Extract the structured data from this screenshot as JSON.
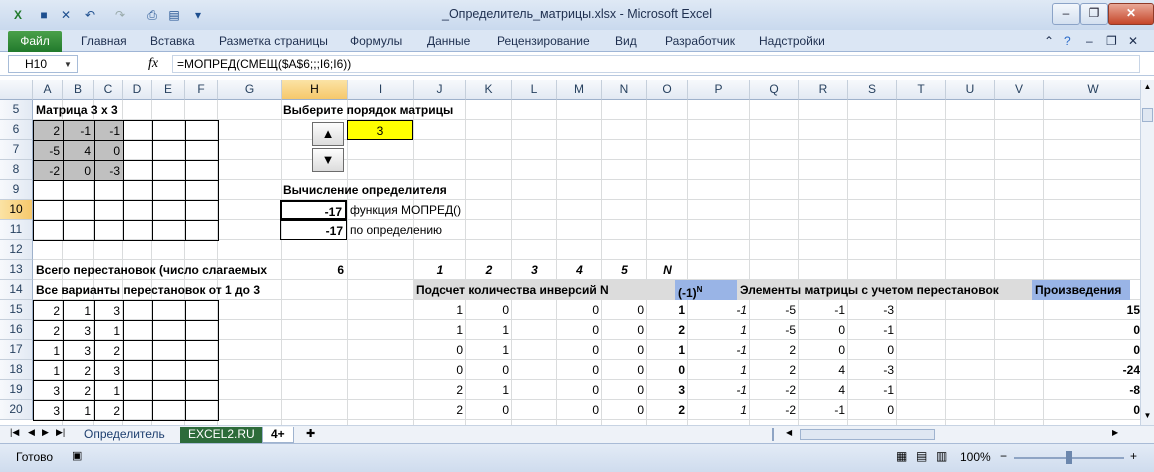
{
  "app": {
    "title": "_Определитель_матрицы.xlsx - Microsoft Excel",
    "file_tab": "Файл",
    "tabs": [
      "Главная",
      "Вставка",
      "Разметка страницы",
      "Формулы",
      "Данные",
      "Рецензирование",
      "Вид",
      "Разработчик",
      "Надстройки"
    ]
  },
  "formula_bar": {
    "name_box": "H10",
    "fx": "fx",
    "formula": "=МОПРЕД(СМЕЩ($A$6;;;I6;I6))"
  },
  "grid": {
    "columns": [
      "A",
      "B",
      "C",
      "D",
      "E",
      "F",
      "G",
      "H",
      "I",
      "J",
      "K",
      "L",
      "M",
      "N",
      "O",
      "P",
      "Q",
      "R",
      "S",
      "T",
      "U",
      "V",
      "W"
    ],
    "rows": [
      "5",
      "6",
      "7",
      "8",
      "9",
      "10",
      "11",
      "12",
      "13",
      "14",
      "15",
      "16",
      "17",
      "18",
      "19",
      "20"
    ],
    "selected_column": "H",
    "selected_row": "10"
  },
  "sheet": {
    "matrix_title": "Матрица 3 х 3",
    "matrix": [
      [
        "2",
        "-1",
        "-1"
      ],
      [
        "-5",
        "4",
        "0"
      ],
      [
        "-2",
        "0",
        "-3"
      ]
    ],
    "choose_order_label": "Выберите порядок матрицы",
    "order_value": "3",
    "spin_up": "▲",
    "spin_down": "▼",
    "calc_title": "Вычисление определителя",
    "det_func_value": "-17",
    "det_func_label": "функция МОПРЕД()",
    "det_def_value": "-17",
    "det_def_label": "по определению",
    "perm_total_label": "Всего перестановок (число слагаемых",
    "perm_total_value": "6",
    "index_header": [
      "1",
      "2",
      "3",
      "4",
      "5",
      "N"
    ],
    "perm_variants_label": "Все варианты перестановок от 1 до 3",
    "inversions_label": "Подсчет количества инверсий N",
    "sign_label": "(-1)",
    "sign_sup": "N",
    "elements_label": "Элементы матрицы с учетом перестановок",
    "products_label": "Произведения",
    "permutations": [
      [
        "2",
        "1",
        "3"
      ],
      [
        "2",
        "3",
        "1"
      ],
      [
        "1",
        "3",
        "2"
      ],
      [
        "1",
        "2",
        "3"
      ],
      [
        "3",
        "2",
        "1"
      ],
      [
        "3",
        "1",
        "2"
      ]
    ],
    "inversion_rows": [
      [
        "1",
        "0",
        "",
        "0",
        "0",
        "1"
      ],
      [
        "1",
        "1",
        "",
        "0",
        "0",
        "2"
      ],
      [
        "0",
        "1",
        "",
        "0",
        "0",
        "1"
      ],
      [
        "0",
        "0",
        "",
        "0",
        "0",
        "0"
      ],
      [
        "2",
        "1",
        "",
        "0",
        "0",
        "3"
      ],
      [
        "2",
        "0",
        "",
        "0",
        "0",
        "2"
      ]
    ],
    "signs": [
      "-1",
      "1",
      "-1",
      "1",
      "-1",
      "1"
    ],
    "elements": [
      [
        "-5",
        "-1",
        "-3"
      ],
      [
        "-5",
        "0",
        "-1"
      ],
      [
        "2",
        "0",
        "0"
      ],
      [
        "2",
        "4",
        "-3"
      ],
      [
        "-2",
        "4",
        "-1"
      ],
      [
        "-2",
        "-1",
        "0"
      ]
    ],
    "products": [
      "15",
      "0",
      "0",
      "-24",
      "-8",
      "0"
    ]
  },
  "sheet_tabs": [
    "Определитель",
    "EXCEL2.RU",
    "4+"
  ],
  "status": {
    "ready": "Готово",
    "zoom": "100%"
  }
}
